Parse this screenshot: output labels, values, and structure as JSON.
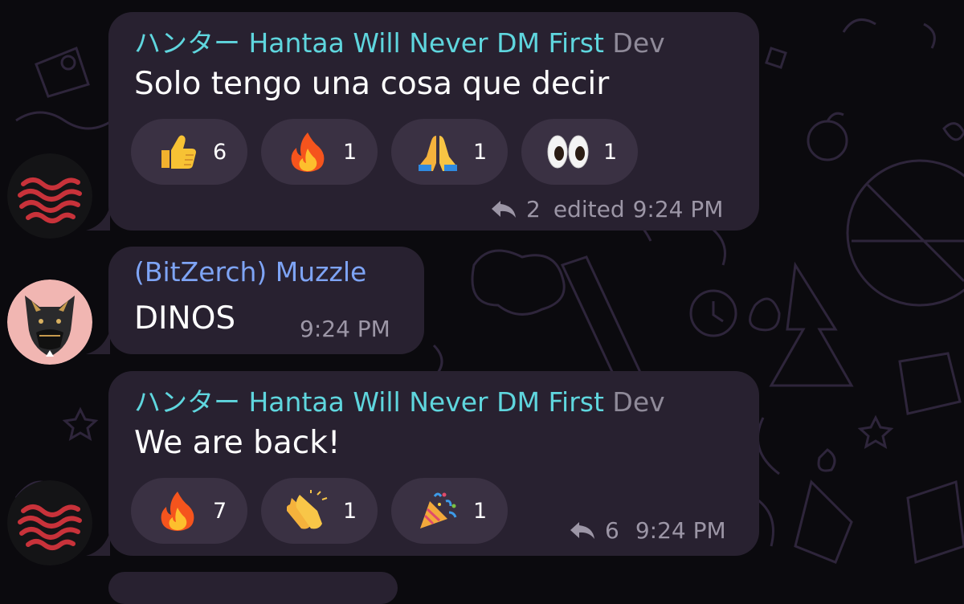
{
  "messages": [
    {
      "sender": "ハンター Hantaa Will Never DM First",
      "role": "Dev",
      "text": "Solo tengo una cosa que decir",
      "reactions": [
        {
          "emoji": "thumbs-up",
          "count": "6"
        },
        {
          "emoji": "fire",
          "count": "1"
        },
        {
          "emoji": "folded-hands",
          "count": "1"
        },
        {
          "emoji": "eyes",
          "count": "1"
        }
      ],
      "replies": "2",
      "edited": "edited",
      "time": "9:24 PM"
    },
    {
      "sender": "(BitZerch) Muzzle",
      "text": "DINOS",
      "time": "9:24 PM"
    },
    {
      "sender": "ハンター Hantaa Will Never DM First",
      "role": "Dev",
      "text": "We are back!",
      "reactions": [
        {
          "emoji": "fire",
          "count": "7"
        },
        {
          "emoji": "clapping-hands",
          "count": "1"
        },
        {
          "emoji": "party-popper",
          "count": "1"
        }
      ],
      "replies": "6",
      "time": "9:24 PM"
    }
  ],
  "colors": {
    "hantaa_name": "#5fd6de",
    "muzzle_name": "#7ea4f5",
    "bubble": "#282130",
    "reaction_pill": "#3a3143",
    "meta": "#9c96a6"
  }
}
